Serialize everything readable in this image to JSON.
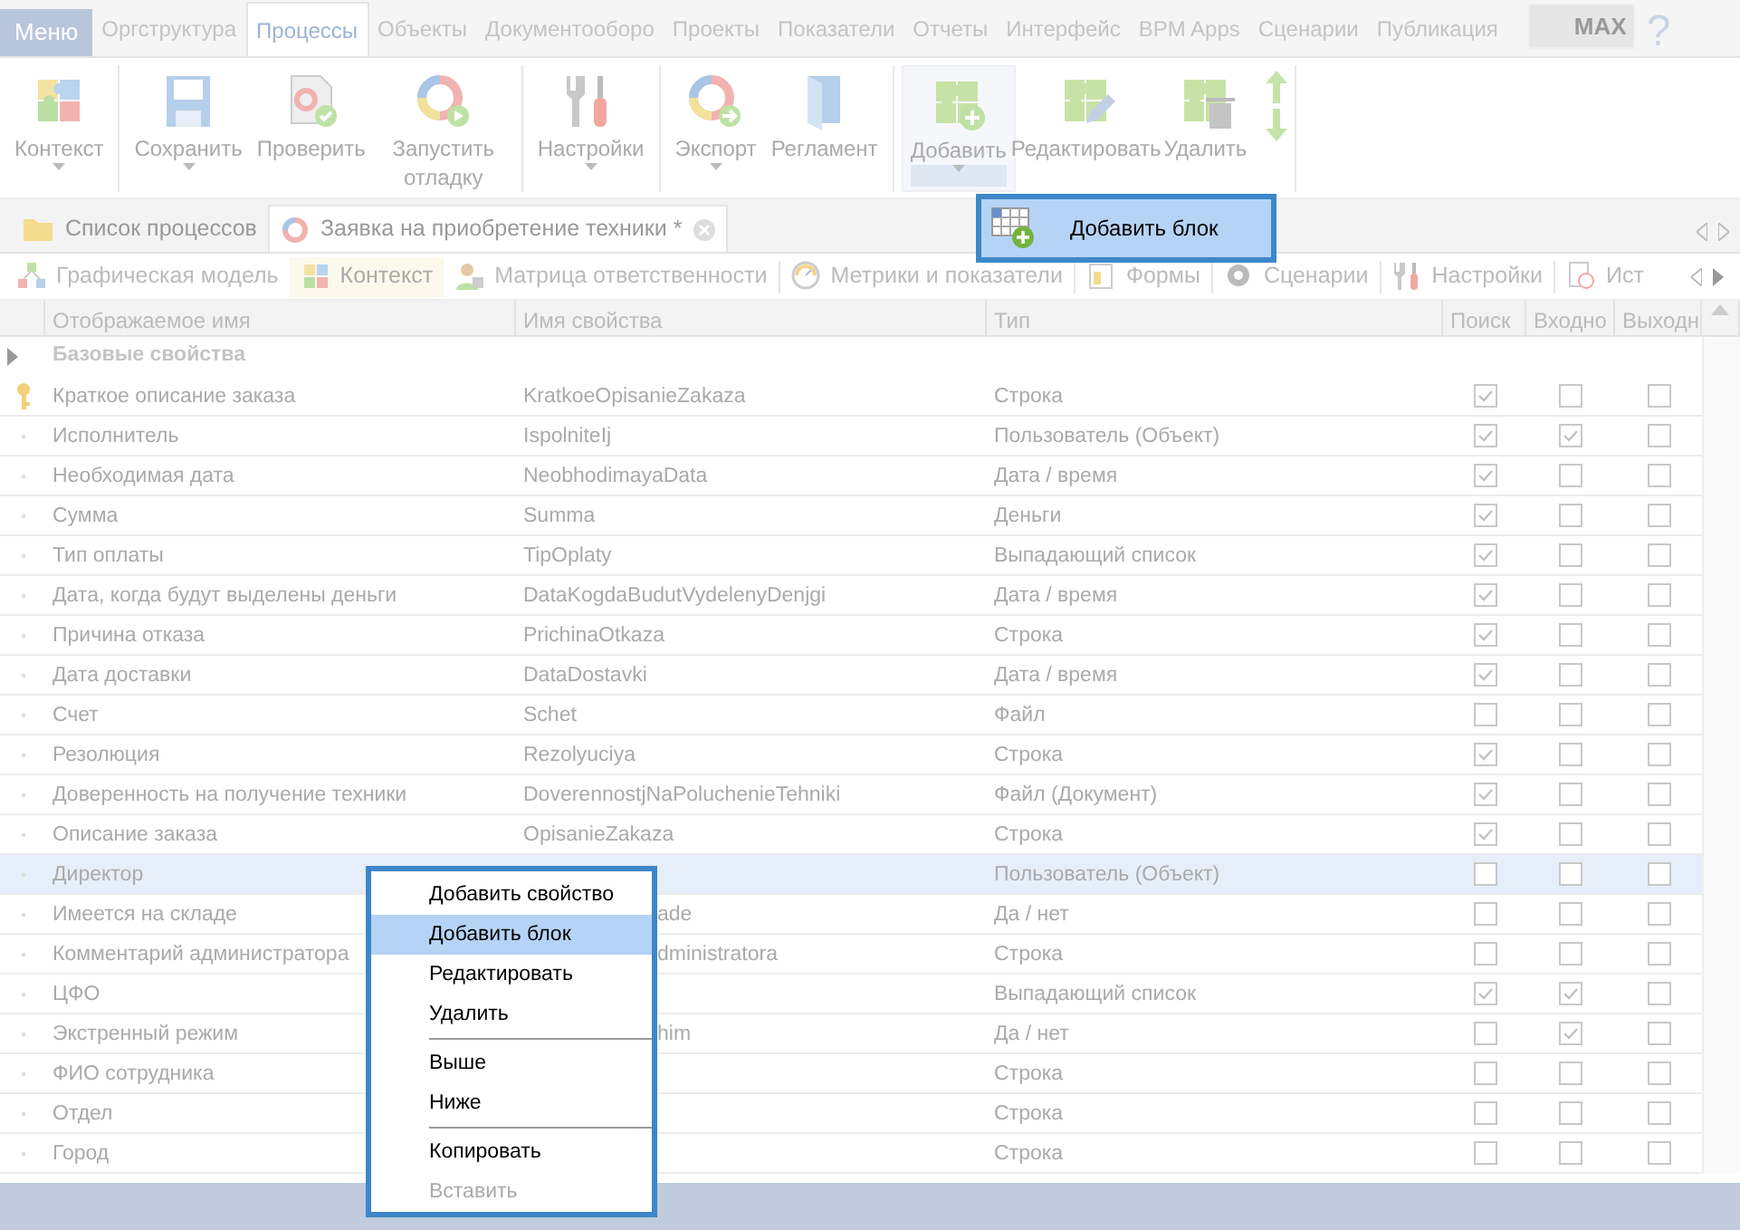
{
  "menu_button": "Меню",
  "main_tabs": [
    {
      "label": "Оргструктура",
      "selected": false
    },
    {
      "label": "Процессы",
      "selected": true
    },
    {
      "label": "Объекты",
      "selected": false
    },
    {
      "label": "Документооборо",
      "selected": false
    },
    {
      "label": "Проекты",
      "selected": false
    },
    {
      "label": "Показатели",
      "selected": false
    },
    {
      "label": "Отчеты",
      "selected": false
    },
    {
      "label": "Интерфейс",
      "selected": false
    },
    {
      "label": "BPM Apps",
      "selected": false
    },
    {
      "label": "Сценарии",
      "selected": false
    },
    {
      "label": "Публикация",
      "selected": false
    }
  ],
  "edition_badge": "MAX",
  "help": "?",
  "ribbon": {
    "groups": [
      [
        {
          "label": "Контекст",
          "dropdown": true,
          "pressed": false
        }
      ],
      [
        {
          "label": "Сохранить",
          "dropdown": true,
          "pressed": false
        },
        {
          "label": "Проверить",
          "dropdown": false,
          "pressed": false
        },
        {
          "label": "Запустить отладку",
          "dropdown": false,
          "pressed": false
        }
      ],
      [
        {
          "label": "Настройки",
          "dropdown": true,
          "pressed": false
        }
      ],
      [
        {
          "label": "Экспорт",
          "dropdown": true,
          "pressed": false
        },
        {
          "label": "Регламент",
          "dropdown": false,
          "pressed": false
        }
      ],
      [
        {
          "label": "Добавить",
          "dropdown": true,
          "pressed": true
        },
        {
          "label": "Редактировать",
          "dropdown": false,
          "pressed": false
        },
        {
          "label": "Удалить",
          "dropdown": false,
          "pressed": false
        }
      ]
    ]
  },
  "dropdown_menu": {
    "items": [
      {
        "label": "Добавить блок",
        "selected": true
      }
    ]
  },
  "doc_tabs": [
    {
      "label": "Список процессов",
      "selected": false,
      "closable": false
    },
    {
      "label": "Заявка на приобретение техники *",
      "selected": true,
      "closable": true
    }
  ],
  "view_toolbar": [
    {
      "label": "Графическая модель",
      "selected": false
    },
    {
      "label": "Контекст",
      "selected": true
    },
    {
      "label": "Матрица ответственности",
      "selected": false
    },
    {
      "label": "Метрики и показатели",
      "selected": false
    },
    {
      "label": "Формы",
      "selected": false
    },
    {
      "label": "Сценарии",
      "selected": false
    },
    {
      "label": "Настройки",
      "selected": false
    },
    {
      "label": "Ист",
      "selected": false
    }
  ],
  "table": {
    "columns": [
      "Отображаемое имя",
      "Имя свойства",
      "Тип",
      "Поиск",
      "Входно",
      "Выходн"
    ],
    "group": {
      "label": "Базовые свойства",
      "expanded": false
    },
    "rows": [
      {
        "name": "Краткое описание заказа",
        "property": "KratkoeOpisanieZakaza",
        "type": "Строка",
        "search": true,
        "input": false,
        "output": false,
        "key": true,
        "selected": false
      },
      {
        "name": "Исполнитель",
        "property": "IspolniteIj",
        "type": "Пользователь (Объект)",
        "search": true,
        "input": true,
        "output": false,
        "key": false,
        "selected": false
      },
      {
        "name": "Необходимая дата",
        "property": "NeobhodimayaData",
        "type": "Дата / время",
        "search": true,
        "input": false,
        "output": false,
        "key": false,
        "selected": false
      },
      {
        "name": "Сумма",
        "property": "Summa",
        "type": "Деньги",
        "search": true,
        "input": false,
        "output": false,
        "key": false,
        "selected": false
      },
      {
        "name": "Тип оплаты",
        "property": "TipOplaty",
        "type": "Выпадающий список",
        "search": true,
        "input": false,
        "output": false,
        "key": false,
        "selected": false
      },
      {
        "name": "Дата, когда будут выделены деньги",
        "property": "DataKogdaBudutVydelenyDenjgi",
        "type": "Дата / время",
        "search": true,
        "input": false,
        "output": false,
        "key": false,
        "selected": false
      },
      {
        "name": "Причина отказа",
        "property": "PrichinaOtkaza",
        "type": "Строка",
        "search": true,
        "input": false,
        "output": false,
        "key": false,
        "selected": false
      },
      {
        "name": "Дата доставки",
        "property": "DataDostavki",
        "type": "Дата / время",
        "search": true,
        "input": false,
        "output": false,
        "key": false,
        "selected": false
      },
      {
        "name": "Счет",
        "property": "Schet",
        "type": "Файл",
        "search": false,
        "input": false,
        "output": false,
        "key": false,
        "selected": false
      },
      {
        "name": "Резолюция",
        "property": "Rezolyuciya",
        "type": "Строка",
        "search": true,
        "input": false,
        "output": false,
        "key": false,
        "selected": false
      },
      {
        "name": "Доверенность на получение техники",
        "property": "DoverennostjNaPoluchenieTehniki",
        "type": "Файл (Документ)",
        "search": true,
        "input": false,
        "output": false,
        "key": false,
        "selected": false
      },
      {
        "name": "Описание заказа",
        "property": "OpisanieZakaza",
        "type": "Строка",
        "search": true,
        "input": false,
        "output": false,
        "key": false,
        "selected": false
      },
      {
        "name": "Директор",
        "type": "Пользователь (Объект)",
        "search": false,
        "input": false,
        "output": false,
        "key": false,
        "selected": true
      },
      {
        "name": "Имеется на складе",
        "property": "ade",
        "type": "Да / нет",
        "search": false,
        "input": false,
        "output": false,
        "key": false,
        "selected": false
      },
      {
        "name": "Комментарий администратора",
        "property": "dministratora",
        "type": "Строка",
        "search": false,
        "input": false,
        "output": false,
        "key": false,
        "selected": false
      },
      {
        "name": "ЦФО",
        "type": "Выпадающий список",
        "search": true,
        "input": true,
        "output": false,
        "key": false,
        "selected": false
      },
      {
        "name": "Экстренный режим",
        "property": "him",
        "type": "Да / нет",
        "search": false,
        "input": true,
        "output": false,
        "key": false,
        "selected": false
      },
      {
        "name": "ФИО сотрудника",
        "type": "Строка",
        "search": false,
        "input": false,
        "output": false,
        "key": false,
        "selected": false
      },
      {
        "name": "Отдел",
        "type": "Строка",
        "search": false,
        "input": false,
        "output": false,
        "key": false,
        "selected": false
      },
      {
        "name": "Город",
        "type": "Строка",
        "search": false,
        "input": false,
        "output": false,
        "key": false,
        "selected": false
      }
    ]
  },
  "context_menu": {
    "groups": [
      [
        {
          "label": "Добавить свойство",
          "selected": false,
          "disabled": false
        },
        {
          "label": "Добавить блок",
          "selected": true,
          "disabled": false
        },
        {
          "label": "Редактировать",
          "selected": false,
          "disabled": false
        },
        {
          "label": "Удалить",
          "selected": false,
          "disabled": false
        }
      ],
      [
        {
          "label": "Выше",
          "selected": false,
          "disabled": false
        },
        {
          "label": "Ниже",
          "selected": false,
          "disabled": false
        }
      ],
      [
        {
          "label": "Копировать",
          "selected": false,
          "disabled": false
        },
        {
          "label": "Вставить",
          "selected": false,
          "disabled": true
        }
      ]
    ]
  }
}
